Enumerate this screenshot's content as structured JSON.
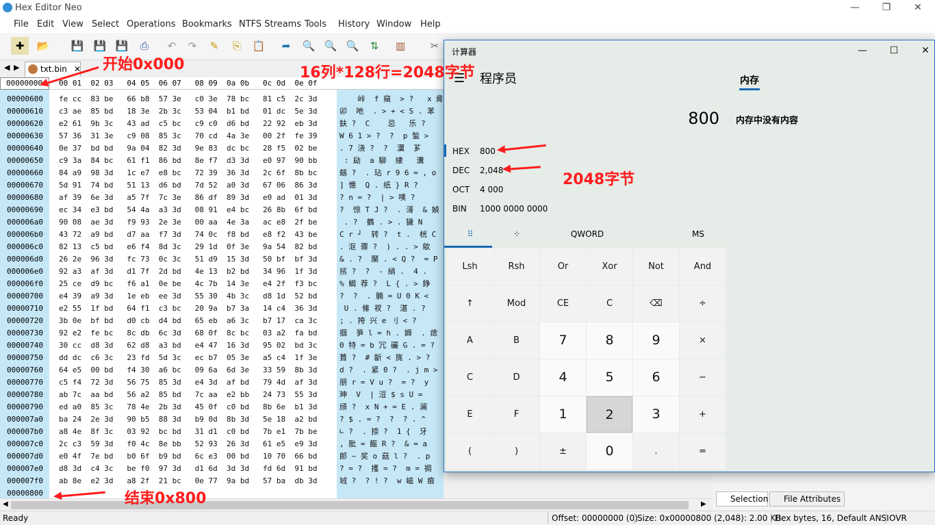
{
  "window": {
    "title": "Hex Editor Neo",
    "min": "—",
    "restore": "❐",
    "close": "✕"
  },
  "menu": [
    "File",
    "Edit",
    "View",
    "Select",
    "Operations",
    "Bookmarks",
    "NTFS Streams",
    "Tools",
    "History",
    "Window",
    "Help"
  ],
  "tab": {
    "name": "txt.bin",
    "close": "✕"
  },
  "hex_header": {
    "offset": "00000000",
    "columns": "00 01  02 03   04 05  06 07   08 09  0a 0b   0c 0d  0e 0f"
  },
  "rows": [
    {
      "offset": "00000600",
      "hex": "fe cc  83 be   66 b8  57 3e   c0 3e  78 bc   81 c5  2c 3d",
      "text": "    峠  f 窺  > ?   x 緅"
    },
    {
      "offset": "00000610",
      "hex": "c3 ae  85 bd   18 3e  2b 3c   53 04  b1 bd   01 dc  5e 3d",
      "text": "卯  吔  . > + < S . 苯"
    },
    {
      "offset": "00000620",
      "hex": "e2 61  9b 3c   43 ad  c5 bc   c9 c0  d6 bd   22 92  eb 3d",
      "text": "鈇 ?  C    忌   乐 ?"
    },
    {
      "offset": "00000630",
      "hex": "57 36  31 3e   c9 08  85 3c   70 cd  4a 3e   00 2f  fe 39",
      "text": "W 6 1 > ?  ?  p 蝵 >"
    },
    {
      "offset": "00000640",
      "hex": "0e 37  bd bd   9a 04  82 3d   9e 83  dc bc   28 f5  02 be",
      "text": ". 7 浇 ?  ?  瀷  芗"
    },
    {
      "offset": "00000650",
      "hex": "c9 3a  84 bc   61 f1  86 bd   8e f7  d3 3d   e0 97  90 bb",
      "text": " : 劶  a 駠  緀   瀵"
    },
    {
      "offset": "00000660",
      "hex": "84 a9  98 3d   1c e7  e8 bc   72 39  36 3d   2c 6f  8b bc",
      "text": "劔 ?  . 玷 r 9 6 = , o"
    },
    {
      "offset": "00000670",
      "hex": "5d 91  74 bd   51 13  d6 bd   7d 52  a0 3d   67 06  86 3d",
      "text": "] 憓  Q . 纸 } R ?"
    },
    {
      "offset": "00000680",
      "hex": "af 39  6e 3d   a5 7f  7c 3e   86 df  89 3d   e0 ad  01 3d",
      "text": "? n = ?  | > 咦 ?"
    },
    {
      "offset": "00000690",
      "hex": "ec 34  e3 bd   54 4a  a3 3d   08 91  e4 bc   26 8b  6f bd",
      "text": "?  惊 T J ?  . 滒  & 媜"
    },
    {
      "offset": "000006a0",
      "hex": "90 08  ae 3d   f9 93  2e 3e   00 aa  4e 3a   ac e8  2f be",
      "text": " . ?  鶴 . > . 獩 N"
    },
    {
      "offset": "000006b0",
      "hex": "43 72  a9 bd   d7 aa  f7 3d   74 0c  f8 bd   e8 f2  43 be",
      "text": "C r ┘  转 ?  t .  桄 C"
    },
    {
      "offset": "000006c0",
      "hex": "82 13  c5 bd   e6 f4  8d 3c   29 1d  0f 3e   9a 54  82 bd",
      "text": ". 沤 骤 ?  ) . . > 歍"
    },
    {
      "offset": "000006d0",
      "hex": "26 2e  96 3d   fc 73  0c 3c   51 d9  15 3d   50 bf  bf 3d",
      "text": "& . ?  黶 . < Q ?  = P"
    },
    {
      "offset": "000006e0",
      "hex": "92 a3  af 3d   d1 7f  2d bd   4e 13  b2 bd   34 96  1f 3d",
      "text": "挘 ?  ?  - 綃 .  4 ."
    },
    {
      "offset": "000006f0",
      "hex": "25 ce  d9 bc   f6 a1  0e be   4c 7b  14 3e   e4 2f  f3 bc",
      "text": "% 蝎 荐 ?  L { . > 錚"
    },
    {
      "offset": "00000700",
      "hex": "e4 39  a9 3d   1e eb  ee 3d   55 30  4b 3c   d8 1d  52 bd",
      "text": "?  ?  . 腩 = U 0 K <"
    },
    {
      "offset": "00000710",
      "hex": "e2 55  1f bd   64 f1  c3 bc   20 9a  b7 3a   14 c4  36 3d",
      "text": " U . 絛 衩 ?  湛 . ?"
    },
    {
      "offset": "00000720",
      "hex": "3b 0e  bf bd   d0 cb  d4 bd   65 eb  a6 3c   b7 17  ca 3c",
      "text": "; . 挎 兴 e 刂 < ?"
    },
    {
      "offset": "00000730",
      "hex": "92 e2  fe bc   8c db  6c 3d   68 0f  8c bc   03 a2  fa bd",
      "text": "掴  芛 l = h . 媷  . 痣"
    },
    {
      "offset": "00000740",
      "hex": "30 cc  d8 3d   62 d8  a3 bd   e4 47  16 3d   95 02  bd 3c",
      "text": "0 特 = b 冗 礹 G . = ?"
    },
    {
      "offset": "00000750",
      "hex": "dd dc  c6 3c   23 fd  5d 3c   ec b7  05 3e   a5 c4  1f 3e",
      "text": "葺 ?  # 齗 < 旄 . > ?"
    },
    {
      "offset": "00000760",
      "hex": "64 e5  00 bd   f4 30  a6 bc   09 6a  6d 3e   33 59  8b 3d",
      "text": "d ?  . 紧 0 ?  . j m >"
    },
    {
      "offset": "00000770",
      "hex": "c5 f4  72 3d   56 75  85 3d   e4 3d  af bd   79 4d  af 3d",
      "text": "朋 r = V u ?  = ?  y"
    },
    {
      "offset": "00000780",
      "hex": "ab 7c  aa bd   56 a2  85 bd   7c aa  e2 bb   24 73  55 3d",
      "text": "珅  V  | 浢 $ s U ="
    },
    {
      "offset": "00000790",
      "hex": "ed a0  85 3c   78 4e  2b 3d   45 0f  c0 bd   8b 6e  b1 3d",
      "text": "頎 ?  x N + = E . 澜"
    },
    {
      "offset": "000007a0",
      "hex": "ba 24  2e 3d   90 b5  88 3d   b9 0d  8b 3d   5e 18  a2 bd",
      "text": "? $ . = ?  ?  ? . ^"
    },
    {
      "offset": "000007b0",
      "hex": "a8 4e  8f 3c   03 92  bc bd   31 d1  c0 bd   7b e1  7b be",
      "text": "∟ ?  . 捺 ?  1 {  牙"
    },
    {
      "offset": "000007c0",
      "hex": "2c c3  59 3d   f0 4c  8e bb   52 93  26 3d   61 e5  e9 3d",
      "text": ", 肶 = 饇 R ?  & = a"
    },
    {
      "offset": "000007d0",
      "hex": "e0 4f  7e bd   b0 6f  b9 bd   6c e3  00 bd   10 70  66 bd",
      "text": "郞 ~ 奖 o 菇 l ?  . p"
    },
    {
      "offset": "000007e0",
      "hex": "d8 3d  c4 3c   be f0  97 3d   d1 6d  3d 3d   fd 6d  91 bd",
      "text": "? = ?  擭 = ?  m = 禂"
    },
    {
      "offset": "000007f0",
      "hex": "ab 8e  e2 3d   a8 2f  21 bc   0e 77  9a bd   57 ba  db 3d",
      "text": "珬 ?  ? ! ?  w 嵫 W 痕"
    },
    {
      "offset": "00000800",
      "hex": "",
      "text": ""
    }
  ],
  "status": {
    "ready": "Ready",
    "offset": "Offset: 00000000 (0)",
    "size": "Size: 0x00000800 (2,048): 2.00 KB",
    "mode": "Hex bytes, 16, Default ANSI",
    "ovr": "OVR"
  },
  "right_tabs": {
    "selection": "Selection",
    "file_attributes": "File Attributes"
  },
  "calculator": {
    "title": "计算器",
    "mode": "程序员",
    "menu_icon": "☰",
    "memory_tab": "内存",
    "display": "800",
    "memory_empty": "内存中没有内容",
    "bases": [
      {
        "label": "HEX",
        "value": "800"
      },
      {
        "label": "DEC",
        "value": "2,048"
      },
      {
        "label": "OCT",
        "value": "4 000"
      },
      {
        "label": "BIN",
        "value": "1000 0000 0000"
      }
    ],
    "keypad_tabs": {
      "full": "⠿",
      "bit": "⁘",
      "word": "QWORD",
      "ms": "MS"
    },
    "keys": [
      [
        "Lsh",
        "Rsh",
        "Or",
        "Xor",
        "Not",
        "And"
      ],
      [
        "↑",
        "Mod",
        "CE",
        "C",
        "⌫",
        "÷"
      ],
      [
        "A",
        "B",
        "7",
        "8",
        "9",
        "×"
      ],
      [
        "C",
        "D",
        "4",
        "5",
        "6",
        "−"
      ],
      [
        "E",
        "F",
        "1",
        "2",
        "3",
        "+"
      ],
      [
        "(",
        ")",
        "±",
        "0",
        ".",
        "="
      ]
    ]
  },
  "annotations": {
    "start": "开始0x000",
    "formula": "16列*128行=2048字节",
    "bytes": "2048字节",
    "end": "结束0x800"
  },
  "colors": {
    "annotation": "#ff1c1c",
    "offset_bg": "#c6e7f6",
    "accent": "#1a6ab5"
  }
}
